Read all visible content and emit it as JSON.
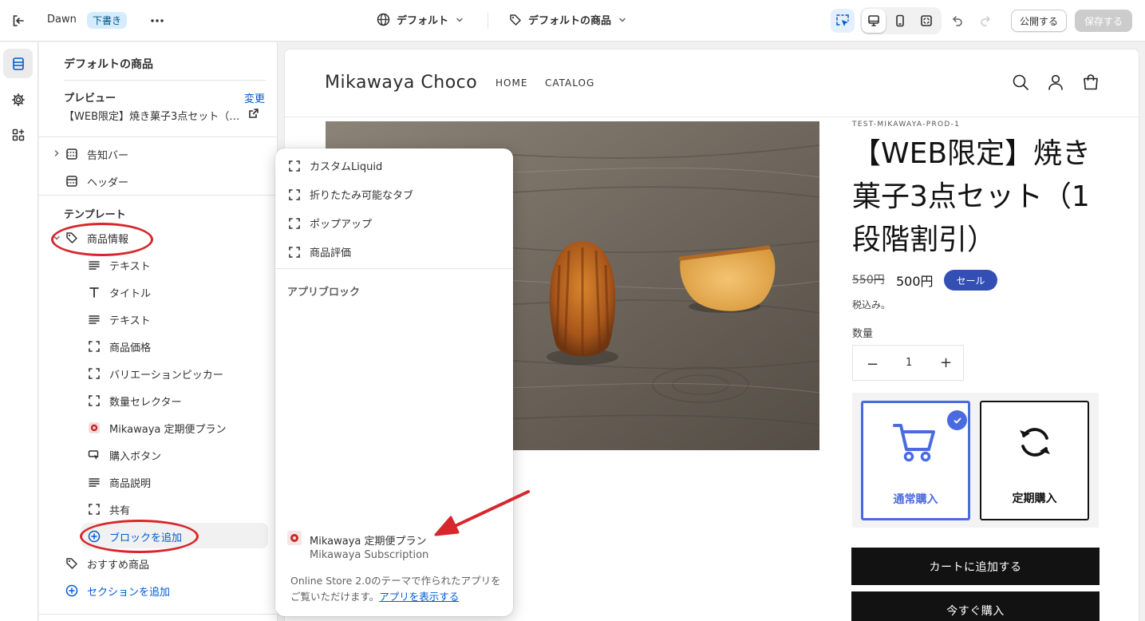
{
  "topbar": {
    "theme_name": "Dawn",
    "draft_badge": "下書き",
    "template_selector": "デフォルト",
    "product_selector": "デフォルトの商品",
    "publish_label": "公開する",
    "save_label": "保存する"
  },
  "sidebar": {
    "title": "デフォルトの商品",
    "preview_label": "プレビュー",
    "change_link": "変更",
    "preview_value": "【WEB限定】焼き菓子3点セット（1段階割引）",
    "header_group": [
      "告知バー",
      "ヘッダー"
    ],
    "template_heading": "テンプレート",
    "product_info": "商品情報",
    "blocks": [
      "テキスト",
      "タイトル",
      "テキスト",
      "商品価格",
      "バリエーションピッカー",
      "数量セレクター",
      "Mikawaya 定期便プラン",
      "購入ボタン",
      "商品説明",
      "共有"
    ],
    "add_block": "ブロックを追加",
    "recommended": "おすすめ商品",
    "add_section": "セクションを追加"
  },
  "popover": {
    "items": [
      "カスタムLiquid",
      "折りたたみ可能なタブ",
      "ポップアップ",
      "商品評価"
    ],
    "app_blocks_heading": "アプリブロック",
    "app_name": "Mikawaya 定期便プラン",
    "app_sub": "Mikawaya Subscription",
    "note": "Online Store 2.0のテーマで作られたアプリをご覧いただけます。",
    "note_link": "アプリを表示する"
  },
  "store": {
    "name": "Mikawaya Choco",
    "nav": [
      "HOME",
      "CATALOG"
    ],
    "sku": "TEST-MIKAWAYA-PROD-1",
    "title": "【WEB限定】焼き菓子3点セット（1段階割引）",
    "old_price": "550円",
    "new_price": "500円",
    "sale_badge": "セール",
    "tax_note": "税込み。",
    "qty_label": "数量",
    "qty_value": "1",
    "option_normal": "通常購入",
    "option_subscribe": "定期購入",
    "add_to_cart": "カートに追加する",
    "buy_now": "今すぐ購入"
  },
  "colors": {
    "accent_blue": "#005bd3",
    "sale_badge": "#334fb4",
    "selected_card": "#4a6be0",
    "annotation_red": "#d8262d"
  }
}
